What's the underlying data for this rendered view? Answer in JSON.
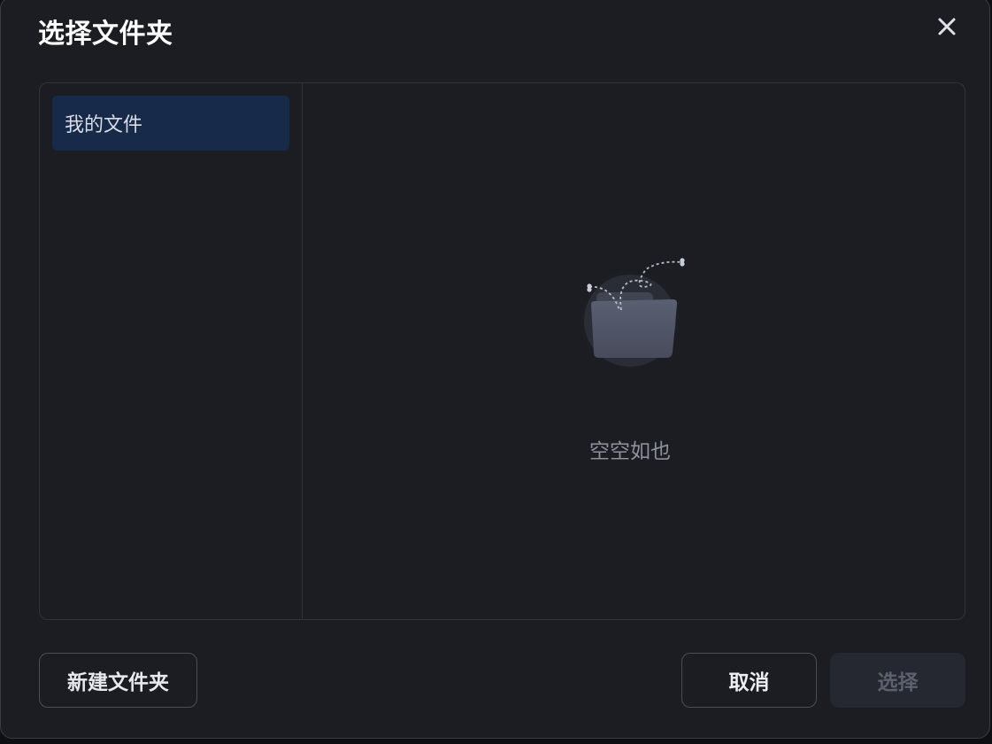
{
  "dialog": {
    "title": "选择文件夹",
    "close_icon": "close-icon"
  },
  "sidebar": {
    "items": [
      {
        "label": "我的文件",
        "selected": true
      }
    ]
  },
  "content": {
    "empty_icon": "empty-folder-icon",
    "empty_text": "空空如也"
  },
  "footer": {
    "new_folder_label": "新建文件夹",
    "cancel_label": "取消",
    "select_label": "选择",
    "select_disabled": true
  },
  "colors": {
    "background": "#1b1d22",
    "selected_item": "#172a4a",
    "text_primary": "#ffffff",
    "text_muted": "#8c919d"
  }
}
